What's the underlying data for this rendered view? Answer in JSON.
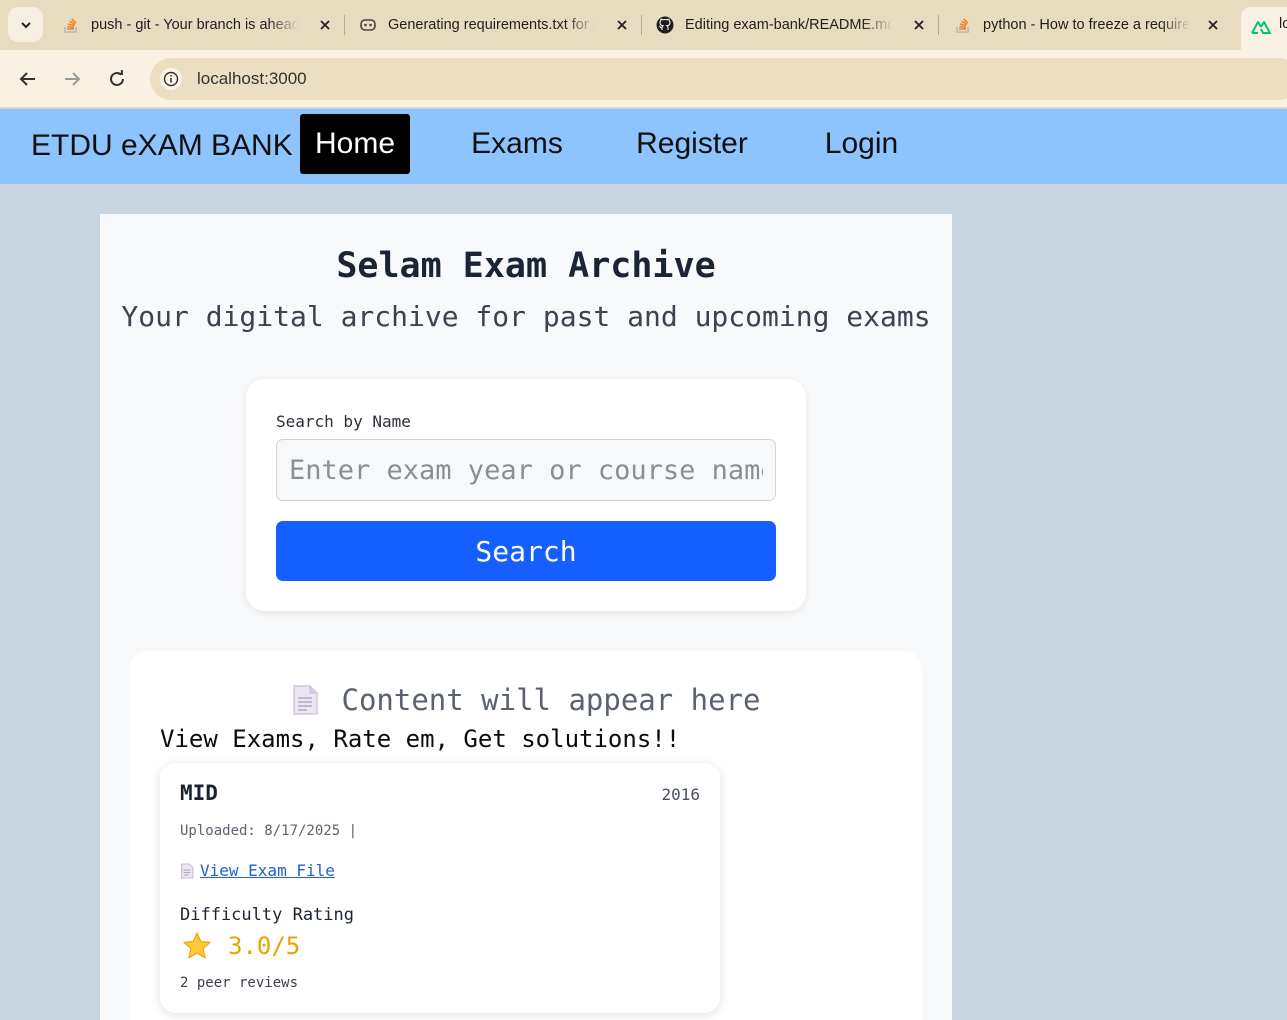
{
  "browser": {
    "tabs": [
      {
        "title": "push - git - Your branch is ahead of 'origin/master'",
        "icon": "stackoverflow-icon"
      },
      {
        "title": "Generating requirements.txt for a Python project",
        "icon": "copilot-icon"
      },
      {
        "title": "Editing exam-bank/README.md at main",
        "icon": "github-icon"
      },
      {
        "title": "python - How to freeze a requirement",
        "icon": "stackoverflow-icon"
      }
    ],
    "active_tab_title": "lo",
    "url": "localhost:3000"
  },
  "site": {
    "brand": "ETDU eXAM BANK",
    "nav": [
      {
        "label": "Home",
        "active": true
      },
      {
        "label": "Exams",
        "active": false
      },
      {
        "label": "Register",
        "active": false
      },
      {
        "label": "Login",
        "active": false
      }
    ]
  },
  "hero": {
    "title": "Selam Exam Archive",
    "subtitle": "Your digital archive for past and upcoming exams"
  },
  "search": {
    "label": "Search by Name",
    "placeholder": "Enter exam year or course name",
    "value": "",
    "button_label": "Search"
  },
  "content": {
    "heading": "Content will appear here",
    "tagline": "View Exams, Rate em, Get solutions!!",
    "exams": [
      {
        "type": "MID",
        "year": "2016",
        "uploaded": "Uploaded: 8/17/2025 |",
        "link_label": "View Exam File",
        "difficulty_label": "Difficulty Rating",
        "rating_text": "3.0/5",
        "rating_value": 3.0,
        "reviews": "2 peer reviews"
      }
    ]
  },
  "colors": {
    "navbar": "#8ec4fd",
    "search_button": "#155eff",
    "rating": "#e9a300",
    "link": "#1d5fd6"
  }
}
